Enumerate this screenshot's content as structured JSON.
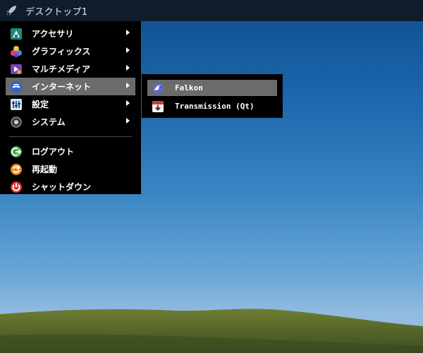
{
  "taskbar": {
    "title": "デスクトップ1",
    "launcher_icon": "rocket-icon"
  },
  "menu": {
    "items": [
      {
        "label": "アクセサリ",
        "icon": "accessories-icon",
        "submenu": true
      },
      {
        "label": "グラフィックス",
        "icon": "graphics-icon",
        "submenu": true
      },
      {
        "label": "マルチメディア",
        "icon": "multimedia-icon",
        "submenu": true
      },
      {
        "label": "インターネット",
        "icon": "internet-icon",
        "submenu": true,
        "active": true
      },
      {
        "label": "設定",
        "icon": "settings-icon",
        "submenu": true
      },
      {
        "label": "システム",
        "icon": "system-icon",
        "submenu": true
      }
    ],
    "actions": [
      {
        "label": "ログアウト",
        "icon": "logout-icon"
      },
      {
        "label": "再起動",
        "icon": "reboot-icon"
      },
      {
        "label": "シャットダウン",
        "icon": "shutdown-icon"
      }
    ]
  },
  "submenu": {
    "items": [
      {
        "label": "Falkon",
        "icon": "falkon-icon",
        "active": true
      },
      {
        "label": "Transmission (Qt)",
        "icon": "transmission-icon"
      }
    ]
  },
  "colors": {
    "taskbar": "#0f1c2a",
    "menu_bg": "#000000",
    "highlight": "#6b6b6b",
    "sky_top": "#0f4f8f",
    "hill": "#5b6a2a"
  }
}
